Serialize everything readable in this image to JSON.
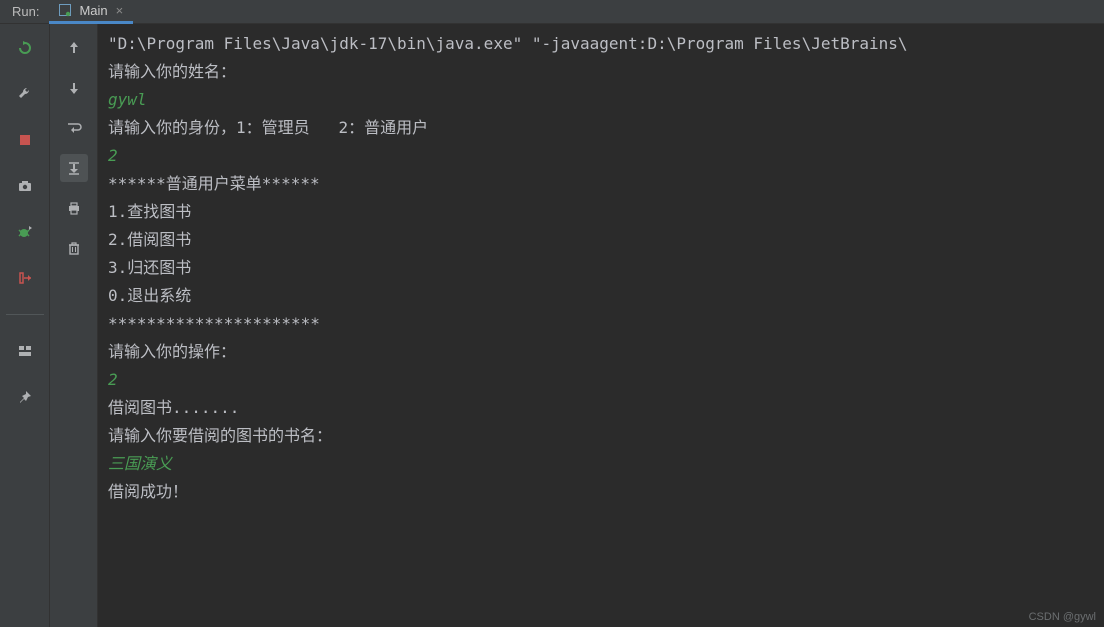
{
  "header": {
    "run_label": "Run:",
    "tab_title": "Main",
    "tab_close": "×"
  },
  "gutter1": {
    "rerun_color": "#499c54",
    "wrench_color": "#afb1b3",
    "stop_color": "#c75450",
    "camera_color": "#afb1b3",
    "bug_color": "#499c54",
    "exit_color": "#c75450",
    "layout_color": "#afb1b3",
    "pin_color": "#afb1b3"
  },
  "gutter2": {
    "up_color": "#afb1b3",
    "down_color": "#afb1b3",
    "wrap_color": "#afb1b3",
    "scroll_color": "#afb1b3",
    "print_color": "#afb1b3",
    "trash_color": "#afb1b3"
  },
  "console": {
    "lines": [
      {
        "style": "ln",
        "text": "\"D:\\Program Files\\Java\\jdk-17\\bin\\java.exe\" \"-javaagent:D:\\Program Files\\JetBrains\\"
      },
      {
        "style": "ln",
        "text": "请输入你的姓名："
      },
      {
        "style": "ln-green",
        "text": "gywl"
      },
      {
        "style": "ln",
        "text": "请输入你的身份，1：管理员   2：普通用户"
      },
      {
        "style": "ln-green",
        "text": "2"
      },
      {
        "style": "ln",
        "text": "******普通用户菜单******"
      },
      {
        "style": "ln",
        "text": "1.查找图书"
      },
      {
        "style": "ln",
        "text": "2.借阅图书"
      },
      {
        "style": "ln",
        "text": "3.归还图书"
      },
      {
        "style": "ln",
        "text": "0.退出系统"
      },
      {
        "style": "ln",
        "text": "**********************"
      },
      {
        "style": "ln",
        "text": "请输入你的操作："
      },
      {
        "style": "ln-green",
        "text": "2"
      },
      {
        "style": "ln",
        "text": "借阅图书......."
      },
      {
        "style": "ln",
        "text": "请输入你要借阅的图书的书名："
      },
      {
        "style": "ln-green",
        "text": "三国演义"
      },
      {
        "style": "ln",
        "text": "借阅成功！"
      }
    ]
  },
  "watermark": "CSDN @gywl"
}
